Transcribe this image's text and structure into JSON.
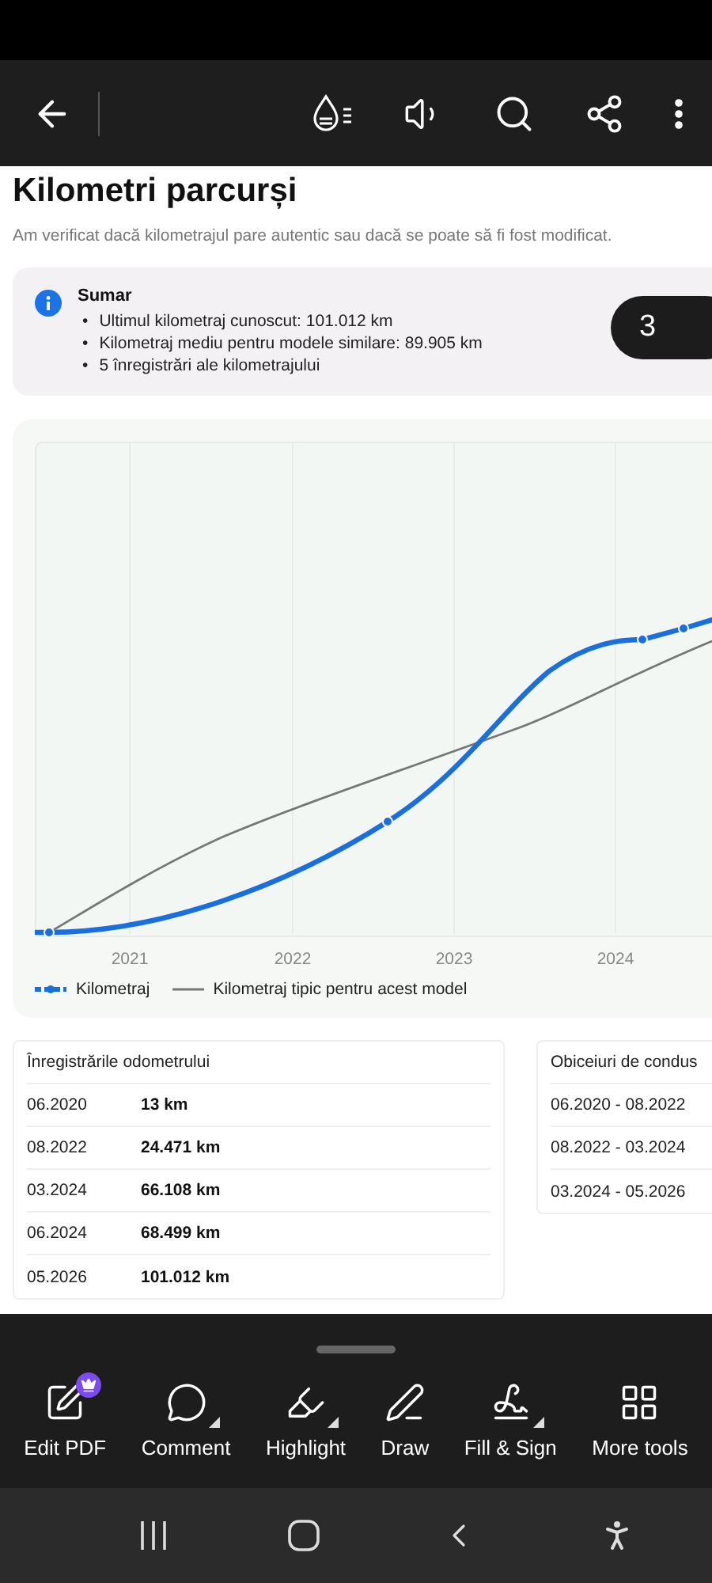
{
  "page": {
    "title": "Kilometri parcurși",
    "subtitle": "Am verificat dacă kilometrajul pare autentic sau dacă se poate să fi fost modificat."
  },
  "summary": {
    "title": "Sumar",
    "items": [
      {
        "marker": "•",
        "text": "Ultimul kilometraj cunoscut: 101.012 km"
      },
      {
        "marker": "•",
        "text": "Kilometraj mediu pentru modele similare: 89.905 km"
      },
      {
        "marker": "•",
        "text": "5 înregistrări ale kilometrajului"
      }
    ],
    "badge": "3"
  },
  "chart": {
    "x_labels": [
      "2021",
      "2022",
      "2023",
      "2024"
    ],
    "legend": [
      {
        "label": "Kilometraj",
        "kind": "dotted"
      },
      {
        "label": "Kilometraj tipic pentru acest model",
        "kind": "solid"
      }
    ]
  },
  "odometer": {
    "title": "Înregistrările odometrului",
    "rows": [
      {
        "date": "06.2020",
        "value": "13 km"
      },
      {
        "date": "08.2022",
        "value": "24.471 km"
      },
      {
        "date": "03.2024",
        "value": "66.108 km"
      },
      {
        "date": "06.2024",
        "value": "68.499 km"
      },
      {
        "date": "05.2026",
        "value": "101.012 km"
      }
    ]
  },
  "habits": {
    "title": "Obiceiuri de condus",
    "rows": [
      "06.2020 - 08.2022",
      "08.2022 - 03.2024",
      "03.2024 - 05.2026"
    ]
  },
  "tools": [
    {
      "label": "Edit PDF",
      "kind": "edit",
      "premium": true,
      "has_menu": false
    },
    {
      "label": "Comment",
      "kind": "comment",
      "premium": false,
      "has_menu": true
    },
    {
      "label": "Highlight",
      "kind": "highlight",
      "premium": false,
      "has_menu": true
    },
    {
      "label": "Draw",
      "kind": "draw",
      "premium": false,
      "has_menu": false
    },
    {
      "label": "Fill & Sign",
      "kind": "sign",
      "premium": false,
      "has_menu": true
    },
    {
      "label": "More tools",
      "kind": "more",
      "premium": false,
      "has_menu": false
    }
  ]
}
